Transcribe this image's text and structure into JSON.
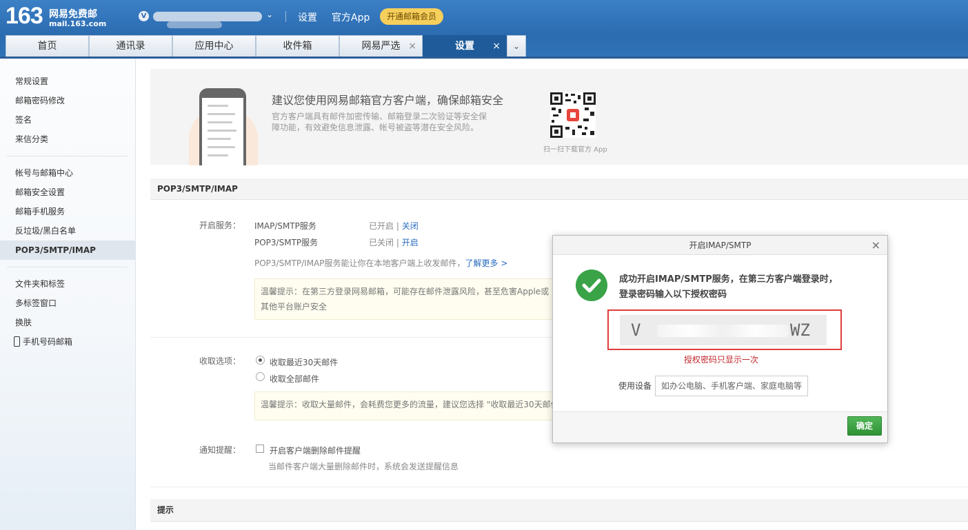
{
  "header": {
    "logo_num": "163",
    "logo_cn": "网易免费邮",
    "logo_domain": "mail.163.com",
    "vip_badge": "V",
    "links": [
      "设置",
      "官方App"
    ],
    "vip_button": "开通邮箱会员"
  },
  "tabs": [
    {
      "label": "首页",
      "closable": false
    },
    {
      "label": "通讯录",
      "closable": false
    },
    {
      "label": "应用中心",
      "closable": false
    },
    {
      "label": "收件箱",
      "closable": false
    },
    {
      "label": "网易严选",
      "closable": true
    },
    {
      "label": "设置",
      "closable": true,
      "active": true
    }
  ],
  "sidebar": {
    "group1": [
      "常规设置",
      "邮箱密码修改",
      "签名",
      "来信分类"
    ],
    "group2": [
      "帐号与邮箱中心",
      "邮箱安全设置",
      "邮箱手机服务",
      "反垃圾/黑白名单",
      "POP3/SMTP/IMAP"
    ],
    "group3": [
      "文件夹和标签",
      "多标签窗口",
      "换肤",
      "手机号码邮箱"
    ],
    "active": "POP3/SMTP/IMAP"
  },
  "banner": {
    "title": "建议您使用网易邮箱官方客户端，确保邮箱安全",
    "desc": "官方客户端具有邮件加密传输、邮箱登录二次验证等安全保障功能，有效避免信息泄露、帐号被盗等潜在安全风险。",
    "qr_caption": "扫一扫下载官方 App"
  },
  "pop3_section": {
    "title": "POP3/SMTP/IMAP",
    "service_label": "开启服务：",
    "imap_name": "IMAP/SMTP服务",
    "imap_status": "已开启",
    "imap_action": "关闭",
    "pop_name": "POP3/SMTP服务",
    "pop_status": "已关闭",
    "pop_action": "开启",
    "divider": "|",
    "info": "POP3/SMTP/IMAP服务能让你在本地客户端上收发邮件，",
    "learn_more": "了解更多 >",
    "tip1": "温馨提示：在第三方登录网易邮箱，可能存在邮件泄露风险，甚至危害Apple或其他平台账户安全",
    "receive_label": "收取选项：",
    "option_30days": "收取最近30天邮件",
    "option_all": "收取全部邮件",
    "tip2": "温馨提示：收取大量邮件，会耗费您更多的流量，建议您选择 \"收取最近30天邮件\"",
    "notify_label": "通知提醒：",
    "notify_option": "开启客户端删除邮件提醒",
    "notify_desc": "当邮件客户端大量删除邮件时，系统会发送提醒信息"
  },
  "tips_section": {
    "title": "提示"
  },
  "modal": {
    "title": "开启IMAP/SMTP",
    "close": "×",
    "message": "成功开启IMAP/SMTP服务，在第三方客户端登录时，登录密码输入以下授权密码",
    "code_start": "V",
    "code_end": "WZ",
    "warning": "授权密码只显示一次",
    "device_label": "使用设备",
    "device_placeholder": "如办公电脑、手机客户端、家庭电脑等",
    "confirm": "确定"
  }
}
